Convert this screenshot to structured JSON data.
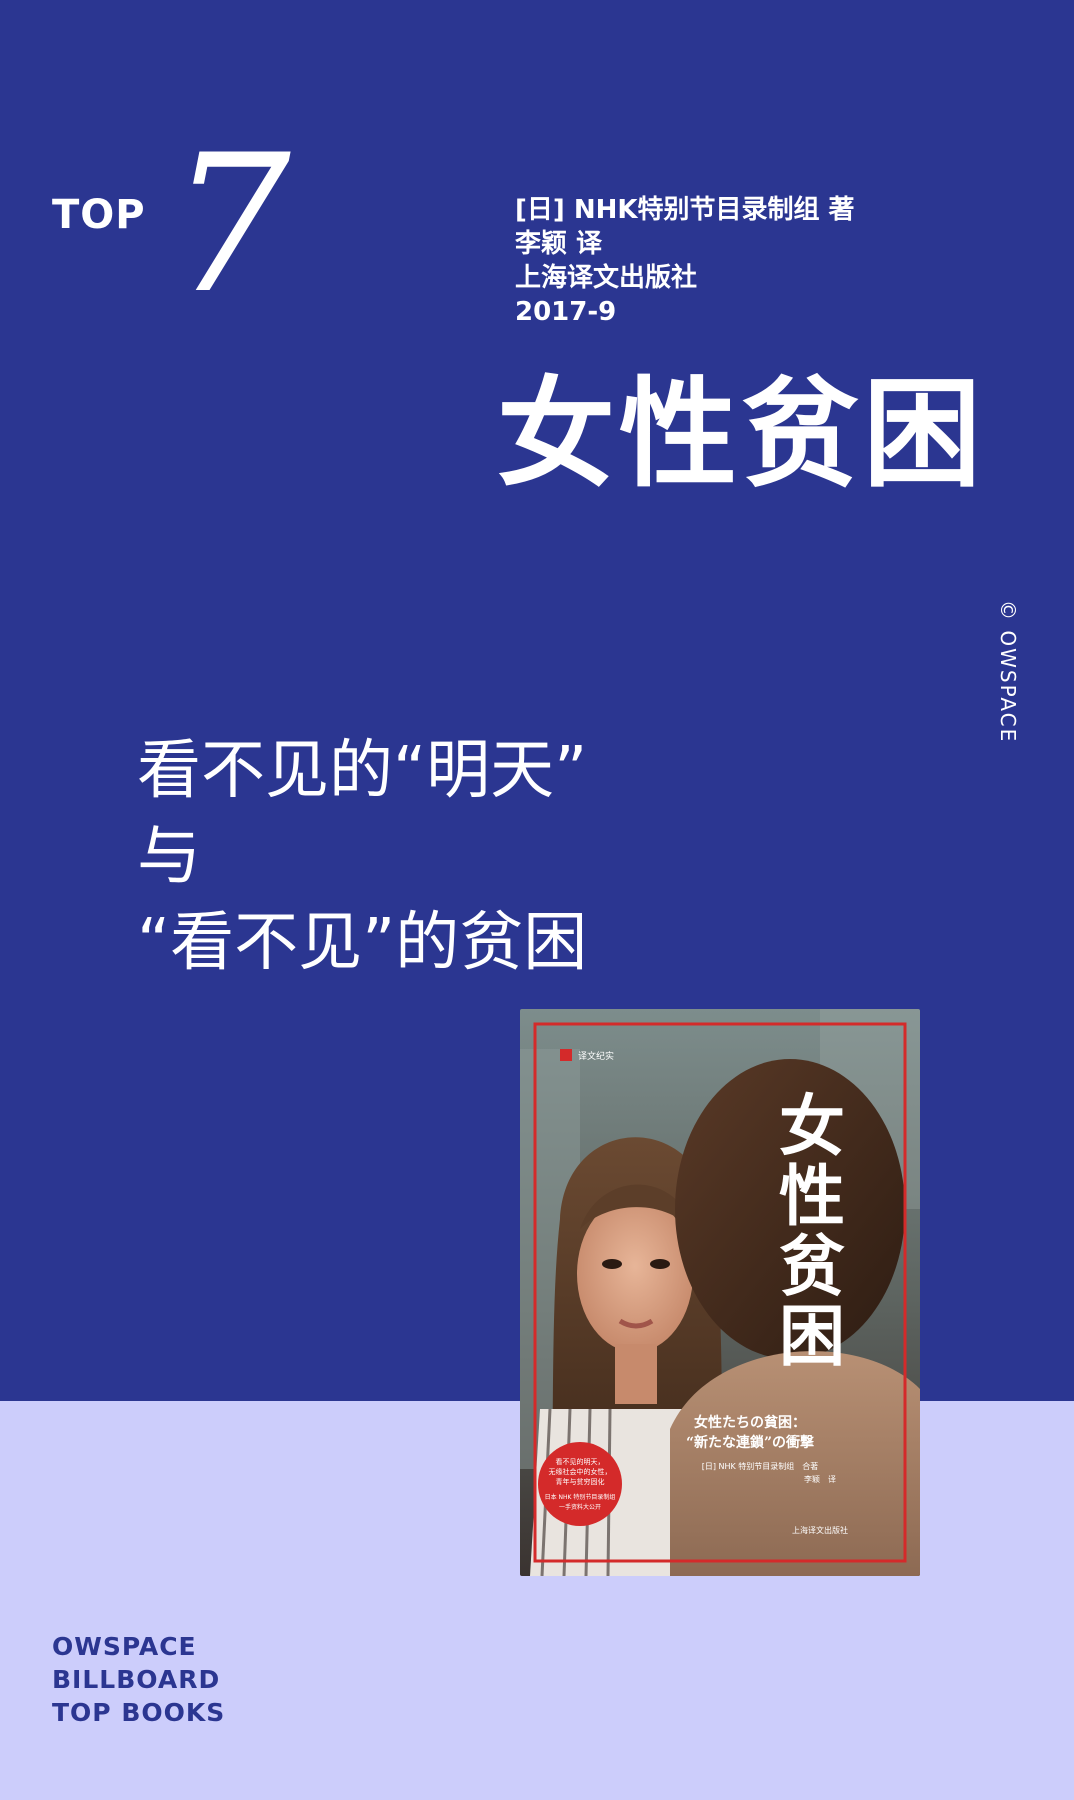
{
  "rank": {
    "label": "TOP",
    "number": "7"
  },
  "book": {
    "author": "[日] NHK特别节目录制组 著",
    "translator": "李颖 译",
    "publisher": "上海译文出版社",
    "date": "2017-9",
    "title": "女性贫困"
  },
  "watermark": "© OWSPACE",
  "tagline": {
    "line1": "看不见的“明天”",
    "line2": "与",
    "line3": "“看不见”的贫困"
  },
  "cover": {
    "series": "译文纪实",
    "title_chars": [
      "女",
      "性",
      "贫",
      "困"
    ],
    "jp_line1": "女性たちの貧困：",
    "jp_line2": "“新たな連鎖”の衝撃",
    "credit_author": "[日] NHK 特别节目录制组　合著",
    "credit_translator": "李颖　译",
    "badge_line1": "看不见的明天，",
    "badge_line2": "无缘社会中的女性，",
    "badge_line3": "青年与贫穷固化",
    "badge_line4": "日本 NHK 特别节目录制组",
    "badge_line5": "一手资料大公开",
    "publisher": "上海译文出版社"
  },
  "footer": {
    "line1": "OWSPACE",
    "line2": "BILLBOARD",
    "line3": "TOP BOOKS"
  },
  "colors": {
    "primary_blue": "#2b3691",
    "light_lavender": "#cccdfb",
    "white": "#ffffff",
    "cover_red": "#d42a2a"
  }
}
